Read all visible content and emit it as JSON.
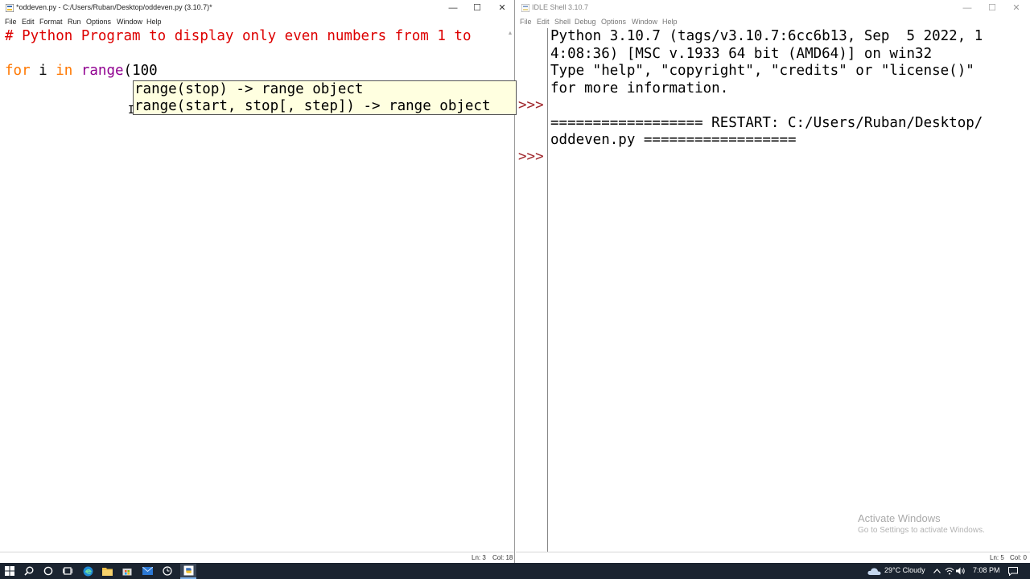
{
  "editor": {
    "title": "*oddeven.py - C:/Users/Ruban/Desktop/oddeven.py (3.10.7)*",
    "menu": [
      "File",
      "Edit",
      "Format",
      "Run",
      "Options",
      "Window",
      "Help"
    ],
    "lines": {
      "comment": "# Python Program to display only even numbers from 1 to",
      "for_kw": "for",
      "loop_var": " i ",
      "in_kw": "in",
      "space": " ",
      "range_builtin": "range",
      "range_args": "(100"
    },
    "calltip": [
      "range(stop) -> range object",
      "range(start, stop[, step]) -> range object"
    ],
    "status": {
      "ln": "Ln: 3",
      "col": "Col: 18"
    }
  },
  "shell": {
    "title": "IDLE Shell 3.10.7",
    "menu": [
      "File",
      "Edit",
      "Shell",
      "Debug",
      "Options",
      "Window",
      "Help"
    ],
    "output_lines": [
      "Python 3.10.7 (tags/v3.10.7:6cc6b13, Sep  5 2022, 1",
      "4:08:36) [MSC v.1933 64 bit (AMD64)] on win32",
      "Type \"help\", \"copyright\", \"credits\" or \"license()\"",
      "for more information.",
      "",
      "================== RESTART: C:/Users/Ruban/Desktop/",
      "oddeven.py =================="
    ],
    "prompts": [
      ">>>",
      ">>>"
    ],
    "status": {
      "ln": "Ln: 5",
      "col": "Col: 0"
    },
    "watermark": {
      "title": "Activate Windows",
      "subtitle": "Go to Settings to activate Windows."
    }
  },
  "taskbar": {
    "weather": "29°C  Cloudy",
    "time": "7:08 PM"
  },
  "colors": {
    "comment": "#dd0000",
    "keyword": "#ff7700",
    "builtin": "#900090",
    "prompt": "#a0282d",
    "calltip_bg": "#ffffe0",
    "taskbar_bg": "#1b2430"
  },
  "icons": [
    "idle-app-icon",
    "minimize-icon",
    "maximize-icon",
    "close-icon",
    "windows-start-icon",
    "search-icon",
    "cortana-icon",
    "task-view-icon",
    "edge-icon",
    "file-explorer-icon",
    "store-icon",
    "mail-icon",
    "clock-app-icon",
    "idle-taskbar-icon",
    "weather-icon",
    "chevron-up-icon",
    "network-icon",
    "volume-icon",
    "notification-icon"
  ]
}
